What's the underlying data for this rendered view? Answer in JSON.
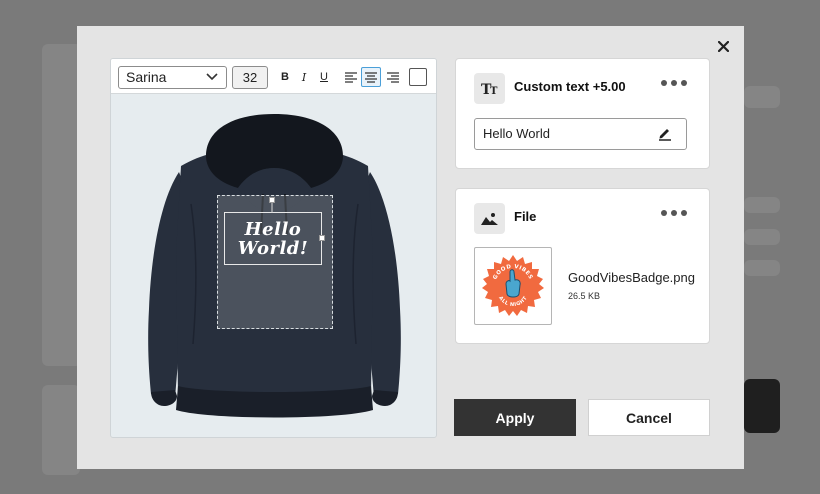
{
  "toolbar": {
    "font": "Sarina",
    "size": "32",
    "bold": "B",
    "italic": "I",
    "underline": "U"
  },
  "preview": {
    "line1": "Hello",
    "line2": "World!"
  },
  "text_card": {
    "title": "Custom text +5.00",
    "value": "Hello World"
  },
  "file_card": {
    "title": "File",
    "file_name": "GoodVibesBadge.png",
    "file_size": "26.5 KB",
    "badge_top": "GOOD VIBES",
    "badge_bottom": "ALL NIGHT"
  },
  "actions": {
    "apply": "Apply",
    "cancel": "Cancel"
  },
  "colors": {
    "hoodie": "#272f3d",
    "badge_orange": "#f16a3f",
    "badge_blue": "#4aa6cf",
    "apply_bg": "#333333"
  }
}
